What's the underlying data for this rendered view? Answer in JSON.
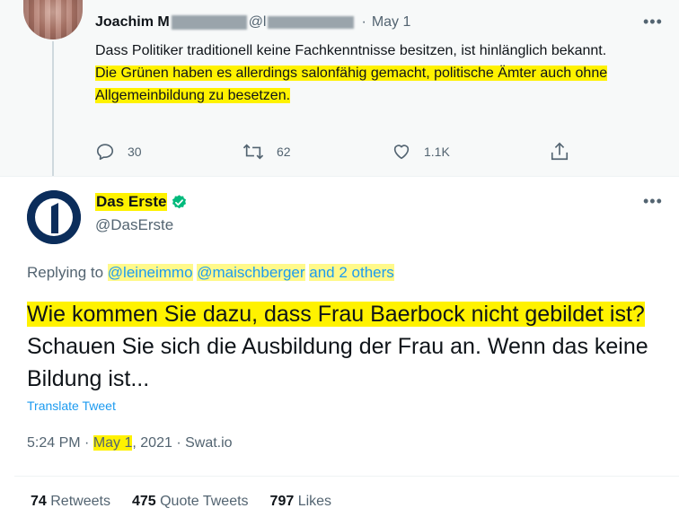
{
  "parent_tweet": {
    "author_name": "Joachim M",
    "handle_start": "@l",
    "date_sep": "·",
    "date": "May 1",
    "text_line1": "Dass Politiker traditionell keine Fachkenntnisse besitzen, ist hinlänglich bekannt.",
    "text_highlighted": "Die Grünen haben es allerdings salonfähig gemacht, politische Ämter auch ohne Allgemeinbildung zu besetzen.",
    "reply_count": "30",
    "retweet_count": "62",
    "like_count": "1.1K",
    "more": "•••"
  },
  "main_tweet": {
    "author_name": "Das Erste",
    "handle": "@DasErste",
    "more": "•••",
    "replying_prefix": "Replying to",
    "replying_to_1": "@leineimmo",
    "replying_to_2": "@maischberger",
    "replying_suffix": "and 2 others",
    "text_highlighted": "Wie kommen Sie dazu, dass Frau Baerbock nicht gebildet ist?",
    "text_rest": " Schauen Sie sich die Ausbildung der Frau an. Wenn das keine Bildung ist...",
    "translate": "Translate Tweet",
    "time": "5:24 PM",
    "sep": " · ",
    "date_highlighted": "May 1",
    "year": ", 2021",
    "source": "Swat.io",
    "retweets_count": "74",
    "retweets_label": "Retweets",
    "quotes_count": "475",
    "quotes_label": "Quote Tweets",
    "likes_count": "797",
    "likes_label": "Likes"
  },
  "colors": {
    "highlight": "#fff200",
    "link": "#1d9bf0",
    "muted": "#536471",
    "verified": "#00ba7c",
    "brand_navy": "#0b2d5b"
  }
}
